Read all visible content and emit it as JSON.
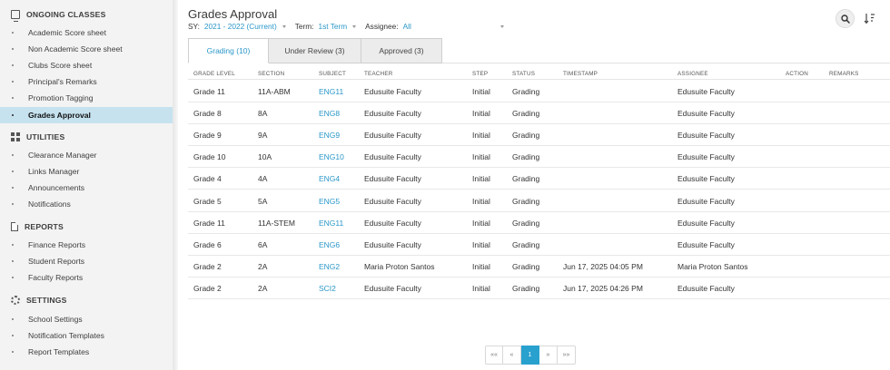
{
  "sidebar": {
    "sections": [
      {
        "label": "ONGOING CLASSES",
        "icon": "monitor-icon"
      },
      {
        "label": "UTILITIES",
        "icon": "grid-icon"
      },
      {
        "label": "REPORTS",
        "icon": "document-icon"
      },
      {
        "label": "SETTINGS",
        "icon": "gear-icon"
      }
    ],
    "ongoing_items": [
      "Academic Score sheet",
      "Non Academic Score sheet",
      "Clubs Score sheet",
      "Principal's Remarks",
      "Promotion Tagging",
      "Grades Approval"
    ],
    "utilities_items": [
      "Clearance Manager",
      "Links Manager",
      "Announcements",
      "Notifications"
    ],
    "reports_items": [
      "Finance Reports",
      "Student Reports",
      "Faculty Reports"
    ],
    "settings_items": [
      "School Settings",
      "Notification Templates",
      "Report Templates"
    ],
    "active_item": "Grades Approval"
  },
  "page": {
    "title": "Grades Approval",
    "filters": {
      "sy_label": "SY:",
      "sy_value": "2021 - 2022 (Current)",
      "term_label": "Term:",
      "term_value": "1st Term",
      "assignee_label": "Assignee:",
      "assignee_value": "All"
    },
    "tabs": [
      "Grading (10)",
      "Under Review (3)",
      "Approved (3)"
    ],
    "active_tab": "Grading (10)"
  },
  "table": {
    "columns": [
      "GRADE LEVEL",
      "SECTION",
      "SUBJECT",
      "TEACHER",
      "STEP",
      "STATUS",
      "TIMESTAMP",
      "ASSIGNEE",
      "ACTION",
      "REMARKS"
    ],
    "rows": [
      {
        "grade": "Grade 11",
        "section": "11A-ABM",
        "subject": "ENG11",
        "teacher": "Edusuite Faculty",
        "step": "Initial",
        "status": "Grading",
        "timestamp": "",
        "assignee": "Edusuite Faculty"
      },
      {
        "grade": "Grade 8",
        "section": "8A",
        "subject": "ENG8",
        "teacher": "Edusuite Faculty",
        "step": "Initial",
        "status": "Grading",
        "timestamp": "",
        "assignee": "Edusuite Faculty"
      },
      {
        "grade": "Grade 9",
        "section": "9A",
        "subject": "ENG9",
        "teacher": "Edusuite Faculty",
        "step": "Initial",
        "status": "Grading",
        "timestamp": "",
        "assignee": "Edusuite Faculty"
      },
      {
        "grade": "Grade 10",
        "section": "10A",
        "subject": "ENG10",
        "teacher": "Edusuite Faculty",
        "step": "Initial",
        "status": "Grading",
        "timestamp": "",
        "assignee": "Edusuite Faculty"
      },
      {
        "grade": "Grade 4",
        "section": "4A",
        "subject": "ENG4",
        "teacher": "Edusuite Faculty",
        "step": "Initial",
        "status": "Grading",
        "timestamp": "",
        "assignee": "Edusuite Faculty"
      },
      {
        "grade": "Grade 5",
        "section": "5A",
        "subject": "ENG5",
        "teacher": "Edusuite Faculty",
        "step": "Initial",
        "status": "Grading",
        "timestamp": "",
        "assignee": "Edusuite Faculty"
      },
      {
        "grade": "Grade 11",
        "section": "11A-STEM",
        "subject": "ENG11",
        "teacher": "Edusuite Faculty",
        "step": "Initial",
        "status": "Grading",
        "timestamp": "",
        "assignee": "Edusuite Faculty"
      },
      {
        "grade": "Grade 6",
        "section": "6A",
        "subject": "ENG6",
        "teacher": "Edusuite Faculty",
        "step": "Initial",
        "status": "Grading",
        "timestamp": "",
        "assignee": "Edusuite Faculty"
      },
      {
        "grade": "Grade 2",
        "section": "2A",
        "subject": "ENG2",
        "teacher": "Maria Proton Santos",
        "step": "Initial",
        "status": "Grading",
        "timestamp": "Jun 17, 2025 04:05 PM",
        "assignee": "Maria Proton Santos"
      },
      {
        "grade": "Grade 2",
        "section": "2A",
        "subject": "SCI2",
        "teacher": "Edusuite Faculty",
        "step": "Initial",
        "status": "Grading",
        "timestamp": "Jun 17, 2025 04:26 PM",
        "assignee": "Edusuite Faculty"
      }
    ]
  },
  "pager": {
    "first": "««",
    "prev": "«",
    "current": "1",
    "next": "»",
    "last": "»»"
  },
  "colors": {
    "accent": "#2a97c9",
    "active_sidebar_bg": "#c6e2ef",
    "pager_active": "#29a1cf"
  }
}
